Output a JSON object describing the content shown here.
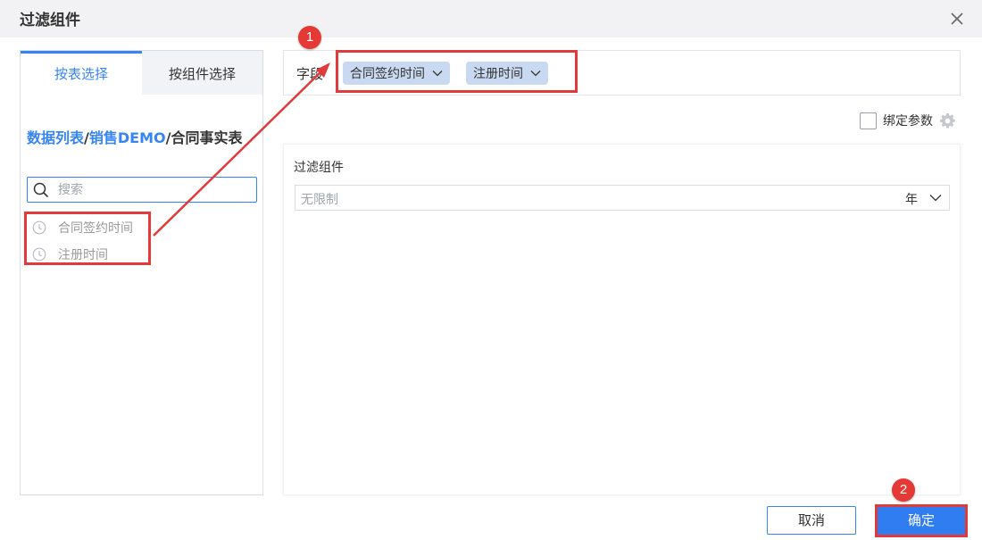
{
  "dialog": {
    "title": "过滤组件"
  },
  "left_panel": {
    "tabs": [
      {
        "label": "按表选择",
        "active": true
      },
      {
        "label": "按组件选择",
        "active": false
      }
    ],
    "breadcrumb": {
      "part1": "数据列表",
      "sep1": "/",
      "part2": "销售DEMO",
      "sep2": "/",
      "current": "合同事实表"
    },
    "search": {
      "placeholder": "搜索",
      "value": ""
    },
    "fields": [
      {
        "label": "合同签约时间",
        "icon": "clock-icon"
      },
      {
        "label": "注册时间",
        "icon": "clock-icon"
      }
    ]
  },
  "field_bar": {
    "label": "字段",
    "chips": [
      {
        "label": "合同签约时间"
      },
      {
        "label": "注册时间"
      }
    ]
  },
  "bind_params": {
    "label": "绑定参数",
    "checked": false
  },
  "config": {
    "title": "过滤组件",
    "dropdown_value": "无限制",
    "dropdown_unit": "年"
  },
  "footer": {
    "cancel_label": "取消",
    "ok_label": "确定"
  },
  "annotations": {
    "badge_1": "1",
    "badge_2": "2"
  },
  "colors": {
    "accent": "#3685f2",
    "highlight": "#e23a3a",
    "chip_bg": "#c9d9f1"
  }
}
